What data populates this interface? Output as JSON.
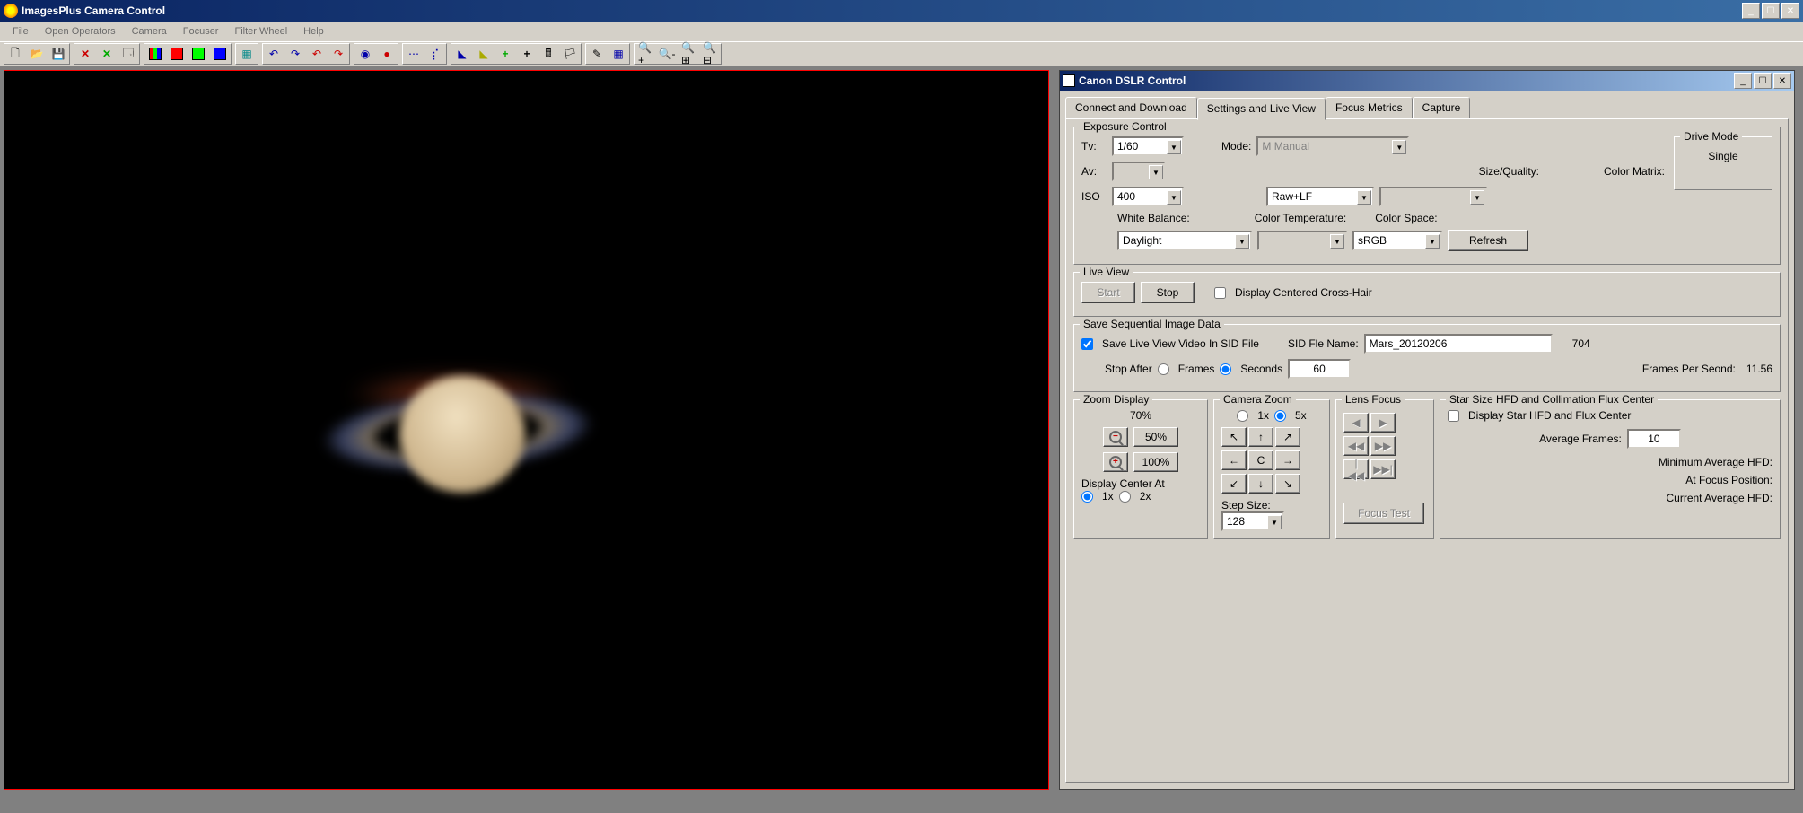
{
  "main_window": {
    "title": "ImagesPlus Camera Control"
  },
  "menubar": [
    "File",
    "Open Operators",
    "Camera",
    "Focuser",
    "Filter Wheel",
    "Help"
  ],
  "dialog": {
    "title": "Canon DSLR Control",
    "tabs": [
      "Connect and Download",
      "Settings and Live View",
      "Focus Metrics",
      "Capture"
    ],
    "active_tab": 1
  },
  "exposure": {
    "legend": "Exposure Control",
    "tv_label": "Tv:",
    "tv_value": "1/60",
    "av_label": "Av:",
    "av_value": "",
    "iso_label": "ISO",
    "iso_value": "400",
    "mode_label": "Mode:",
    "mode_value": "M Manual",
    "size_label": "Size/Quality:",
    "size_value": "Raw+LF",
    "colormatrix_label": "Color Matrix:",
    "colormatrix_value": "",
    "wb_label": "White Balance:",
    "wb_value": "Daylight",
    "colortemp_label": "Color Temperature:",
    "colortemp_value": "",
    "colorspace_label": "Color Space:",
    "colorspace_value": "sRGB",
    "refresh": "Refresh",
    "drivemode_legend": "Drive Mode",
    "drivemode_value": "Single"
  },
  "liveview": {
    "legend": "Live View",
    "start": "Start",
    "stop": "Stop",
    "crosshair_label": "Display Centered Cross-Hair"
  },
  "sid": {
    "legend": "Save Sequential Image Data",
    "save_label": "Save Live View Video In SID File",
    "fname_label": "SID Fle Name:",
    "fname_value": "Mars_20120206",
    "count": "704",
    "stopafter_label": "Stop After",
    "frames_label": "Frames",
    "seconds_label": "Seconds",
    "stop_value": "60",
    "fps_label": "Frames Per Seond:",
    "fps_value": "11.56"
  },
  "zoomdisplay": {
    "legend": "Zoom Display",
    "percent": "70%",
    "b50": "50%",
    "b100": "100%",
    "center_label": "Display Center At",
    "x1": "1x",
    "x2": "2x"
  },
  "camerazoom": {
    "legend": "Camera Zoom",
    "x1": "1x",
    "x5": "5x",
    "center_btn": "C",
    "stepsize_label": "Step Size:",
    "stepsize_value": "128"
  },
  "lensfocus": {
    "legend": "Lens Focus",
    "test": "Focus Test"
  },
  "starsize": {
    "legend": "Star Size HFD and Collimation Flux Center",
    "display_label": "Display Star HFD and Flux Center",
    "avgframes_label": "Average Frames:",
    "avgframes_value": "10",
    "min_label": "Minimum Average HFD:",
    "atfocus_label": "At Focus Position:",
    "current_label": "Current Average HFD:"
  },
  "arrows": {
    "nw": "↖",
    "n": "↑",
    "ne": "↗",
    "w": "←",
    "e": "→",
    "sw": "↙",
    "s": "↓",
    "se": "↘",
    "l": "◀",
    "r": "▶",
    "ll": "◀◀",
    "rr": "▶▶",
    "lll": "|◀◀",
    "rrr": "▶▶|"
  }
}
